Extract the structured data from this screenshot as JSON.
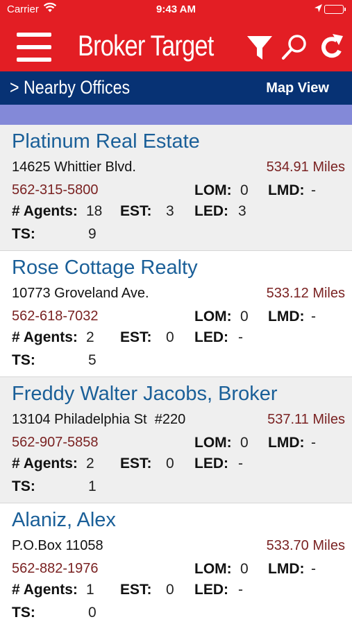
{
  "status_bar": {
    "carrier": "Carrier",
    "time": "9:43 AM",
    "wifi_icon": "wifi-icon",
    "location_icon": "location-arrow-icon",
    "battery_icon": "battery-icon"
  },
  "header": {
    "title": "Broker Target",
    "background_color": "#e31e24",
    "menu_icon": "hamburger-menu-icon",
    "filter_icon": "filter-funnel-icon",
    "search_icon": "search-icon",
    "refresh_icon": "refresh-icon"
  },
  "nav": {
    "back_label": "> Nearby Offices",
    "map_view_label": "Map View",
    "background_color": "#073274"
  },
  "labels": {
    "lom": "LOM:",
    "lmd": "LMD:",
    "agents": "# Agents:",
    "est": "EST:",
    "led": "LED:",
    "ts": "TS:"
  },
  "offices": [
    {
      "name": "Platinum Real Estate",
      "address": "14625 Whittier Blvd.",
      "distance": "534.91 Miles",
      "phone": "562-315-5800",
      "lom": "0",
      "lmd": "-",
      "agents": "18",
      "est": "3",
      "led": "3",
      "ts": "9"
    },
    {
      "name": "Rose Cottage Realty",
      "address": "10773 Groveland Ave.",
      "distance": "533.12 Miles",
      "phone": "562-618-7032",
      "lom": "0",
      "lmd": "-",
      "agents": "2",
      "est": "0",
      "led": "-",
      "ts": "5"
    },
    {
      "name": "Freddy Walter Jacobs, Broker",
      "address": "13104 Philadelphia St  #220",
      "distance": "537.11 Miles",
      "phone": "562-907-5858",
      "lom": "0",
      "lmd": "-",
      "agents": "2",
      "est": "0",
      "led": "-",
      "ts": "1"
    },
    {
      "name": "Alaniz, Alex",
      "address": "P.O.Box 11058",
      "distance": "533.70 Miles",
      "phone": "562-882-1976",
      "lom": "0",
      "lmd": "-",
      "agents": "1",
      "est": "0",
      "led": "-",
      "ts": "0"
    }
  ]
}
